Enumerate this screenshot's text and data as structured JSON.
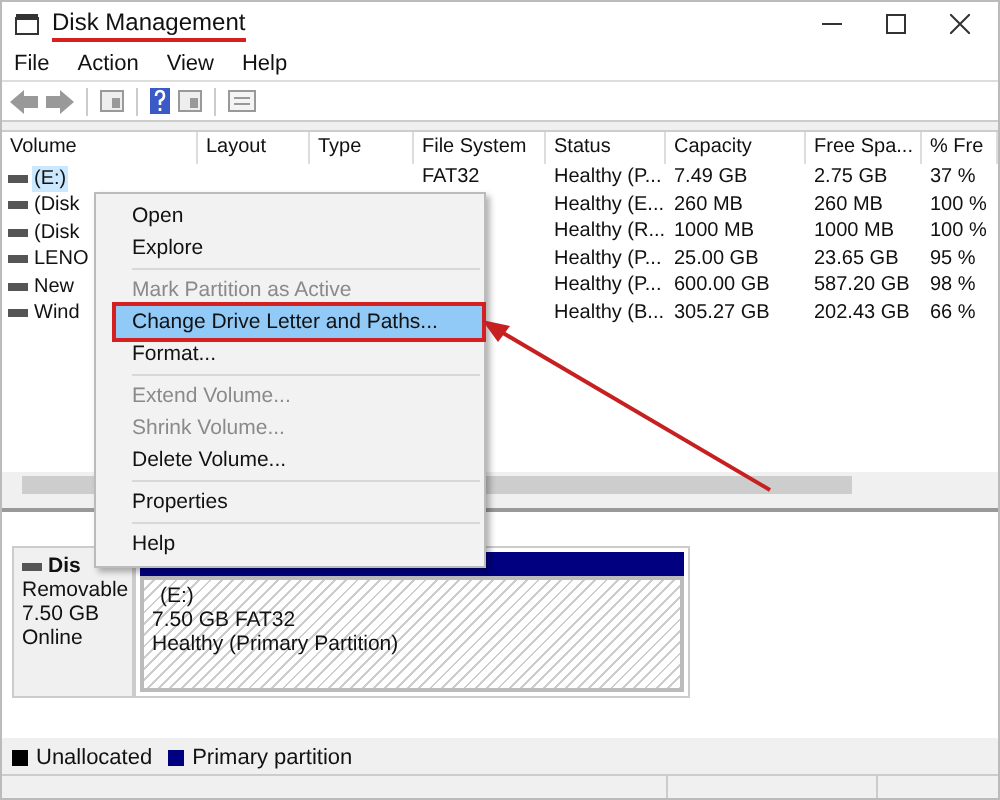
{
  "window": {
    "title": "Disk Management"
  },
  "menu_bar": [
    "File",
    "Action",
    "View",
    "Help"
  ],
  "table": {
    "columns": [
      "Volume",
      "Layout",
      "Type",
      "File System",
      "Status",
      "Capacity",
      "Free Spa...",
      "% Fre"
    ],
    "rows": [
      {
        "selected": true,
        "cells": [
          "(E:)",
          "",
          "",
          "FAT32",
          "Healthy (P...",
          "7.49 GB",
          "2.75 GB",
          "37 %"
        ]
      },
      {
        "selected": false,
        "cells": [
          "(Disk",
          "",
          "",
          "",
          "Healthy (E...",
          "260 MB",
          "260 MB",
          "100 %"
        ]
      },
      {
        "selected": false,
        "cells": [
          "(Disk",
          "",
          "",
          "",
          "Healthy (R...",
          "1000 MB",
          "1000 MB",
          "100 %"
        ]
      },
      {
        "selected": false,
        "cells": [
          "LENO",
          "",
          "",
          "",
          "Healthy (P...",
          "25.00 GB",
          "23.65 GB",
          "95 %"
        ]
      },
      {
        "selected": false,
        "cells": [
          "New",
          "",
          "",
          "",
          "Healthy (P...",
          "600.00 GB",
          "587.20 GB",
          "98 %"
        ]
      },
      {
        "selected": false,
        "cells": [
          "Wind",
          "",
          "",
          "",
          "Healthy (B...",
          "305.27 GB",
          "202.43 GB",
          "66 %"
        ]
      }
    ]
  },
  "context_menu": [
    {
      "label": "Open",
      "disabled": false,
      "highlighted": false,
      "separator_after": false
    },
    {
      "label": "Explore",
      "disabled": false,
      "highlighted": false,
      "separator_after": true
    },
    {
      "label": "Mark Partition as Active",
      "disabled": true,
      "highlighted": false,
      "separator_after": false
    },
    {
      "label": "Change Drive Letter and Paths...",
      "disabled": false,
      "highlighted": true,
      "separator_after": false
    },
    {
      "label": "Format...",
      "disabled": false,
      "highlighted": false,
      "separator_after": true
    },
    {
      "label": "Extend Volume...",
      "disabled": true,
      "highlighted": false,
      "separator_after": false
    },
    {
      "label": "Shrink Volume...",
      "disabled": true,
      "highlighted": false,
      "separator_after": false
    },
    {
      "label": "Delete Volume...",
      "disabled": false,
      "highlighted": false,
      "separator_after": true
    },
    {
      "label": "Properties",
      "disabled": false,
      "highlighted": false,
      "separator_after": true
    },
    {
      "label": "Help",
      "disabled": false,
      "highlighted": false,
      "separator_after": false
    }
  ],
  "disk": {
    "name": "Dis",
    "lines": [
      "Removable",
      "7.50 GB",
      "Online"
    ]
  },
  "partition": {
    "name": "(E:)",
    "size": "7.50 GB FAT32",
    "status": "Healthy (Primary Partition)"
  },
  "legend": [
    {
      "label": "Unallocated",
      "color": "#000000"
    },
    {
      "label": "Primary partition",
      "color": "#000080"
    }
  ]
}
